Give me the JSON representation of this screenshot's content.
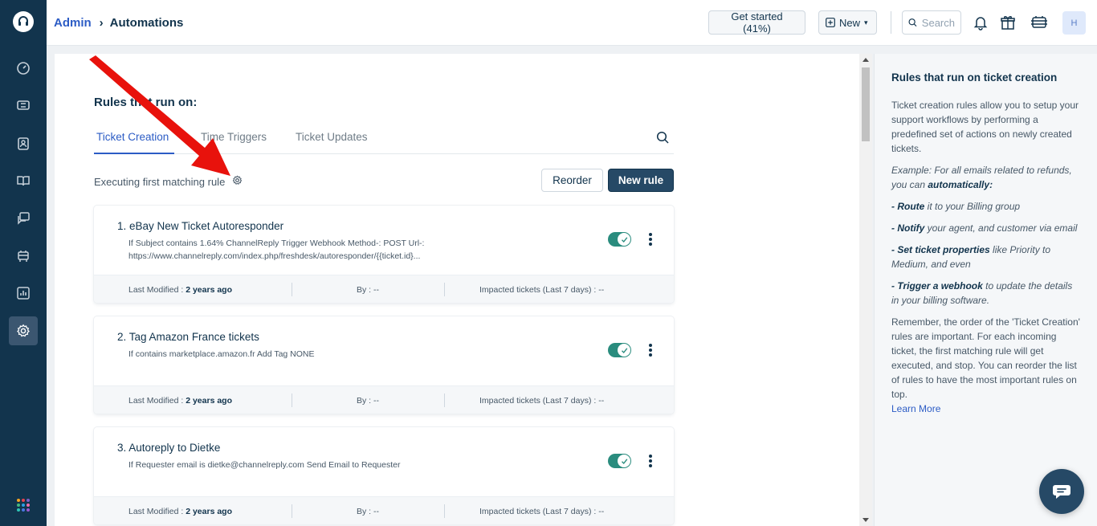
{
  "header": {
    "breadcrumb_root": "Admin",
    "breadcrumb_page": "Automations",
    "get_started": "Get started (41%)",
    "new_label": "New",
    "search_placeholder": "Search",
    "avatar_initial": "H"
  },
  "main": {
    "title": "Rules that run on:",
    "tabs": [
      {
        "label": "Ticket Creation",
        "active": true
      },
      {
        "label": "Time Triggers",
        "active": false
      },
      {
        "label": "Ticket Updates",
        "active": false
      }
    ],
    "executing_label": "Executing first matching rule",
    "reorder_label": "Reorder",
    "new_rule_label": "New rule",
    "rules": [
      {
        "title": "1. eBay New Ticket Autoresponder",
        "desc_line1": "If Subject contains 1.64% ChannelReply Trigger Webhook Method-: POST Url-:",
        "desc_line2": "https://www.channelreply.com/index.php/freshdesk/autoresponder/{{ticket.id}...",
        "enabled": true,
        "last_modified_label": "Last Modified : ",
        "last_modified": "2 years ago",
        "by": "By : --",
        "impacted": "Impacted tickets (Last 7 days) : --"
      },
      {
        "title": "2. Tag Amazon France tickets",
        "desc_line1": "If contains marketplace.amazon.fr Add Tag NONE",
        "desc_line2": "",
        "enabled": true,
        "last_modified_label": "Last Modified : ",
        "last_modified": "2 years ago",
        "by": "By : --",
        "impacted": "Impacted tickets (Last 7 days) : --"
      },
      {
        "title": "3. Autoreply to Dietke",
        "desc_line1": "If Requester email is dietke@channelreply.com Send Email to Requester",
        "desc_line2": "",
        "enabled": true,
        "last_modified_label": "Last Modified : ",
        "last_modified": "2 years ago",
        "by": "By : --",
        "impacted": "Impacted tickets (Last 7 days) : --"
      }
    ]
  },
  "side": {
    "title": "Rules that run on ticket creation",
    "intro": "Ticket creation rules allow you to setup your support workflows by performing a predefined set of actions on newly created tickets.",
    "example_prefix": "Example: For all emails related to refunds, you can ",
    "example_bold": "automatically:",
    "items": [
      {
        "bold": "- Route",
        "rest": " it to your Billing group"
      },
      {
        "bold": "- Notify",
        "rest": " your agent, and customer via email"
      },
      {
        "bold": "- Set ticket properties",
        "rest": " like Priority to Medium, and even"
      },
      {
        "bold": "- Trigger a webhook",
        "rest": " to update the details in your billing software."
      }
    ],
    "remember": "Remember, the order of the 'Ticket Creation' rules are important. For each incoming ticket, the first matching rule will get executed, and stop. You can reorder the list of rules to have the most important rules on top.",
    "learn_more": "Learn More"
  },
  "colors": {
    "nav_bg": "#12344d",
    "accent": "#2c5cc5",
    "toggle_on": "#2a8c7e",
    "primary_button": "#264966",
    "annotation_arrow": "#e8120c"
  },
  "icons": [
    "headset-logo-icon",
    "dashboard-icon",
    "tickets-icon",
    "contacts-icon",
    "solutions-icon",
    "conversations-icon",
    "team-icon",
    "reports-icon",
    "admin-gear-icon",
    "apps-grid-icon",
    "bell-icon",
    "gift-icon",
    "tools-icon",
    "search-icon",
    "chat-icon"
  ]
}
